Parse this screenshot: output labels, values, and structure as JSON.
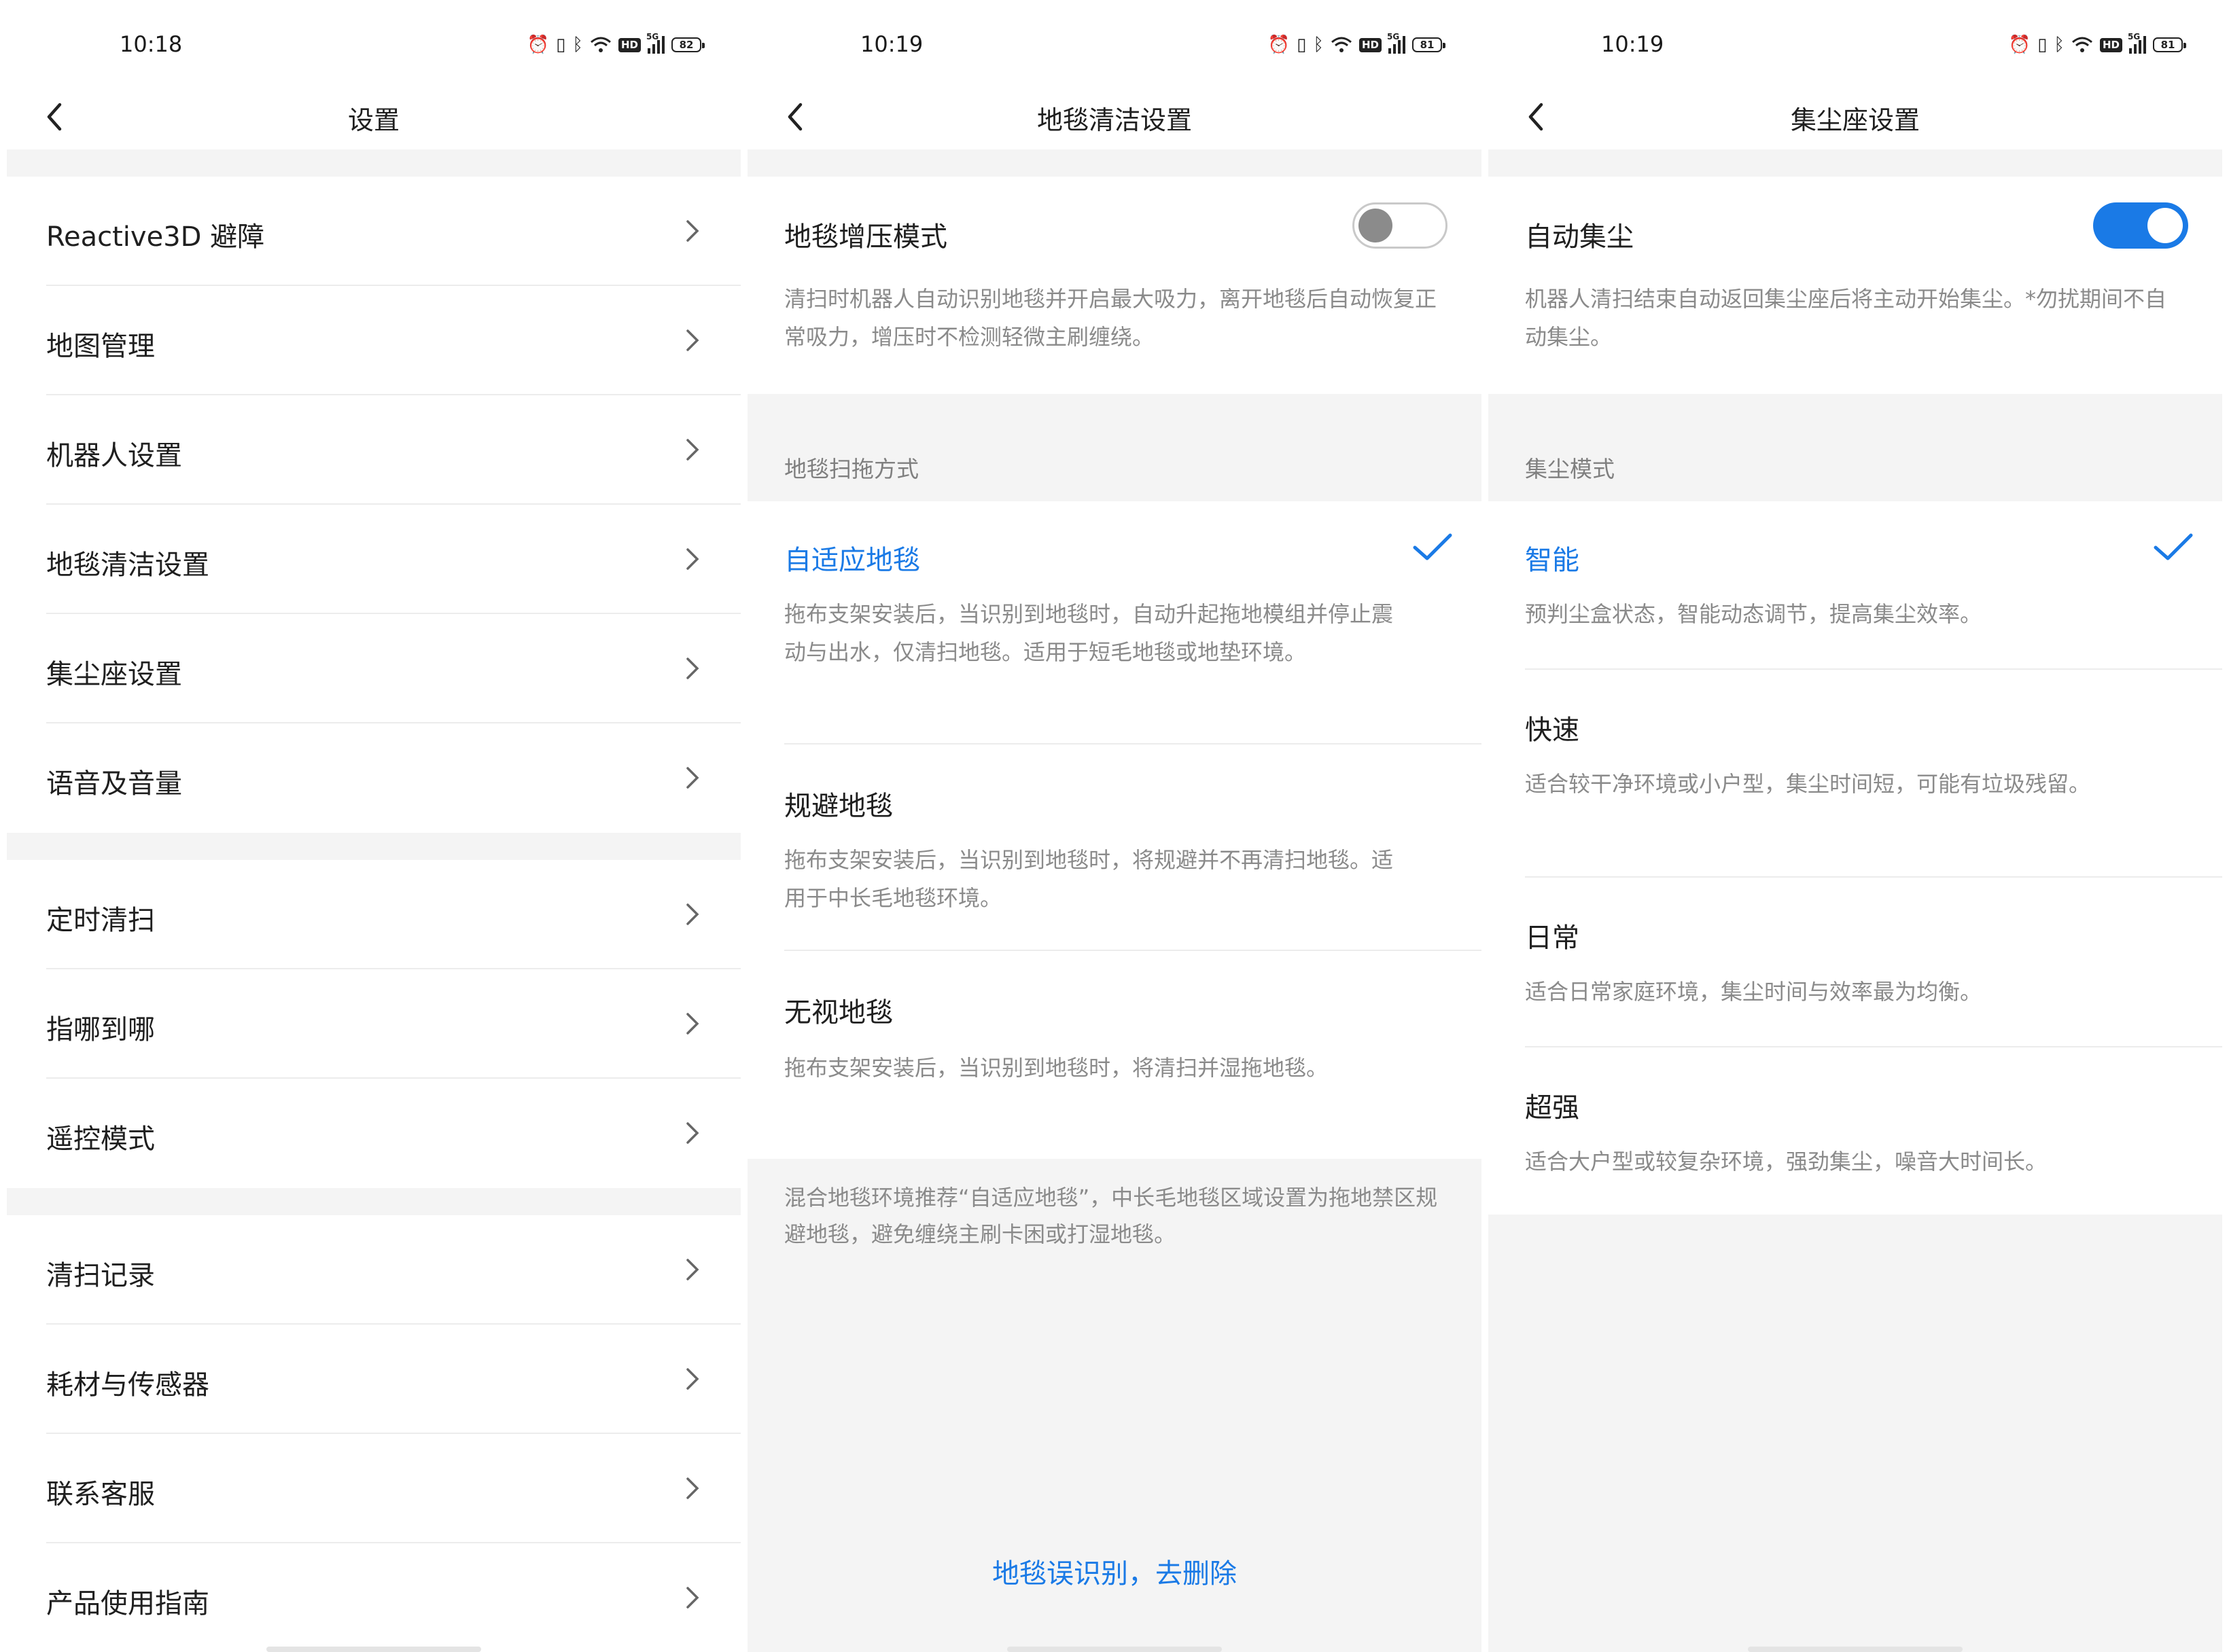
{
  "screens": [
    {
      "status": {
        "time": "10:18",
        "battery": "82",
        "net": "5G"
      },
      "title": "设置",
      "groups": [
        [
          "Reactive3D 避障",
          "地图管理",
          "机器人设置",
          "地毯清洁设置",
          "集尘座设置",
          "语音及音量"
        ],
        [
          "定时清扫",
          "指哪到哪",
          "遥控模式"
        ],
        [
          "清扫记录",
          "耗材与传感器",
          "联系客服",
          "产品使用指南"
        ]
      ]
    },
    {
      "status": {
        "time": "10:19",
        "battery": "81",
        "net": "5G"
      },
      "title": "地毯清洁设置",
      "switch": {
        "label": "地毯增压模式",
        "on": false,
        "desc": "清扫时机器人自动识别地毯并开启最大吸力，离开地毯后自动恢复正常吸力，增压时不检测轻微主刷缠绕。"
      },
      "section": "地毯扫拖方式",
      "options": [
        {
          "title": "自适应地毯",
          "desc": "拖布支架安装后，当识别到地毯时，自动升起拖地模组并停止震动与出水，仅清扫地毯。适用于短毛地毯或地垫环境。",
          "selected": true
        },
        {
          "title": "规避地毯",
          "desc": "拖布支架安装后，当识别到地毯时，将规避并不再清扫地毯。适用于中长毛地毯环境。",
          "selected": false
        },
        {
          "title": "无视地毯",
          "desc": "拖布支架安装后，当识别到地毯时，将清扫并湿拖地毯。",
          "selected": false
        }
      ],
      "note": "混合地毯环境推荐“自适应地毯”，中长毛地毯区域设置为拖地禁区规避地毯，避免缠绕主刷卡困或打湿地毯。",
      "link": "地毯误识别，去删除"
    },
    {
      "status": {
        "time": "10:19",
        "battery": "81",
        "net": "5G"
      },
      "title": "集尘座设置",
      "switch": {
        "label": "自动集尘",
        "on": true,
        "desc": "机器人清扫结束自动返回集尘座后将主动开始集尘。*勿扰期间不自动集尘。"
      },
      "section": "集尘模式",
      "options": [
        {
          "title": "智能",
          "desc": "预判尘盒状态，智能动态调节，提高集尘效率。",
          "selected": true
        },
        {
          "title": "快速",
          "desc": "适合较干净环境或小户型，集尘时间短，可能有垃圾残留。",
          "selected": false
        },
        {
          "title": "日常",
          "desc": "适合日常家庭环境，集尘时间与效率最为均衡。",
          "selected": false
        },
        {
          "title": "超强",
          "desc": "适合大户型或较复杂环境，强劲集尘，噪音大时间长。",
          "selected": false
        }
      ]
    }
  ],
  "colors": {
    "accent": "#1a7ae6",
    "text": "#1f1f1f",
    "muted": "#8a8a8a",
    "bg": "#f4f4f4"
  },
  "icons": {
    "back": "chevron-left-icon",
    "row": "chevron-right-icon",
    "check": "check-icon",
    "alarm": "alarm-icon",
    "vibrate": "vibrate-icon",
    "bluetooth": "bluetooth-icon",
    "wifi": "wifi-icon"
  }
}
